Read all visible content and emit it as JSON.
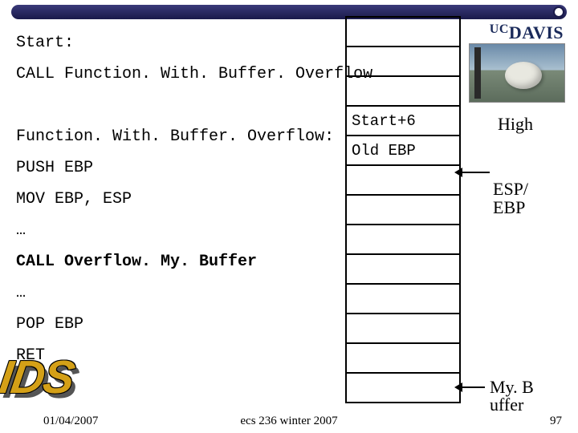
{
  "logo": {
    "uc": "UC",
    "davis": "DAVIS"
  },
  "code": {
    "l1": "Start:",
    "l2": "CALL Function. With. Buffer. Overflow",
    "l3": "Function. With. Buffer. Overflow:",
    "l4": "PUSH EBP",
    "l5": "MOV EBP, ESP",
    "l6": "…",
    "l7": "CALL Overflow. My. Buffer",
    "l8": "…",
    "l9": "POP EBP",
    "l10": "RET"
  },
  "stack": {
    "cells": [
      "",
      "",
      "",
      "Start+6",
      "Old EBP",
      "",
      "",
      "",
      "",
      "",
      "",
      "",
      ""
    ]
  },
  "annot": {
    "high": "High",
    "esp_ebp_line1": "ESP/",
    "esp_ebp_line2": "EBP",
    "mybuffer_line1": "My. B",
    "mybuffer_line2": "uffer"
  },
  "footer": {
    "date": "01/04/2007",
    "title": "ecs 236 winter 2007",
    "pagenum": "97"
  }
}
